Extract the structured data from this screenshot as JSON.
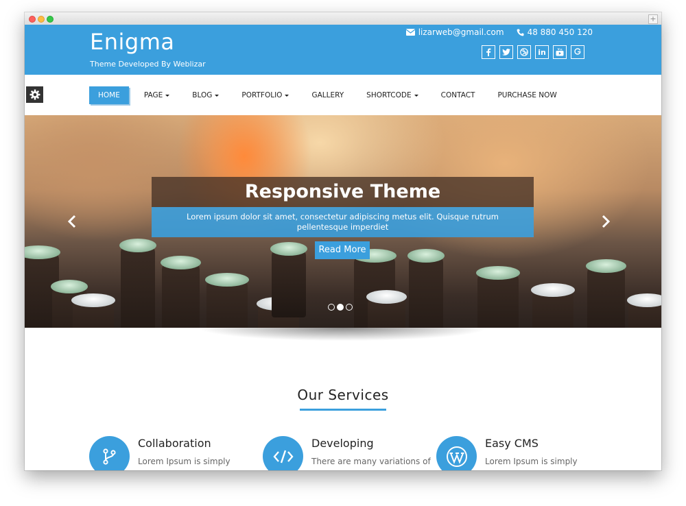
{
  "site": {
    "brand": "Enigma",
    "tagline": "Theme Developed By Weblizar",
    "email": "lizarweb@gmail.com",
    "phone": "48 880 450 120",
    "social_icons": [
      "facebook-icon",
      "twitter-icon",
      "dribbble-icon",
      "linkedin-icon",
      "youtube-icon",
      "google-plus-icon"
    ],
    "accent_color": "#3b9fdd"
  },
  "nav": {
    "items": [
      {
        "label": "HOME",
        "active": true
      },
      {
        "label": "PAGE",
        "dropdown": true
      },
      {
        "label": "BLOG",
        "dropdown": true
      },
      {
        "label": "PORTFOLIO",
        "dropdown": true
      },
      {
        "label": "GALLERY"
      },
      {
        "label": "SHORTCODE",
        "dropdown": true
      },
      {
        "label": "CONTACT"
      },
      {
        "label": "PURCHASE NOW"
      }
    ]
  },
  "hero": {
    "title": "Responsive Theme",
    "subtitle": "Lorem ipsum dolor sit amet, consectetur adipiscing metus elit. Quisque rutrum pellentesque imperdiet",
    "button": "Read More",
    "slides": 3,
    "active_slide": 2
  },
  "services": {
    "heading": "Our Services",
    "items": [
      {
        "title": "Collaboration",
        "desc": "Lorem Ipsum is simply",
        "icon": "git-branch-icon"
      },
      {
        "title": "Developing",
        "desc": "There are many variations of",
        "icon": "code-icon"
      },
      {
        "title": "Easy CMS",
        "desc": "Lorem Ipsum is simply",
        "icon": "wordpress-icon"
      }
    ]
  }
}
